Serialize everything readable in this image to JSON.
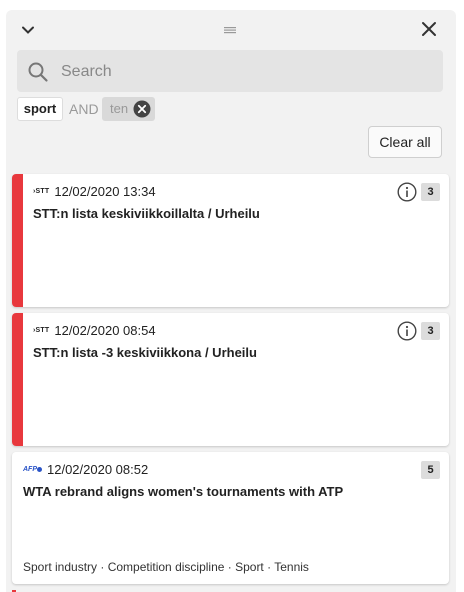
{
  "search": {
    "placeholder": "Search",
    "value": ""
  },
  "filters": [
    {
      "label": "sport"
    },
    {
      "operator": "AND"
    },
    {
      "label": "ten"
    }
  ],
  "clear_all_label": "Clear all",
  "colors": {
    "urgent": "#e8383d",
    "afp": "#2a54c7"
  },
  "items": [
    {
      "source": "STT",
      "source_icon": "stt-logo",
      "date": "12/02/2020 13:34",
      "title": "STT:n lista keskiviikkoillalta / Urheilu",
      "count": "3",
      "urgent": true,
      "has_info": true,
      "tags": ""
    },
    {
      "source": "STT",
      "source_icon": "stt-logo",
      "date": "12/02/2020 08:54",
      "title": "STT:n lista -3 keskiviikkona / Urheilu",
      "count": "3",
      "urgent": true,
      "has_info": true,
      "tags": ""
    },
    {
      "source": "AFP",
      "source_icon": "afp-logo",
      "date": "12/02/2020 08:52",
      "title": "WTA rebrand aligns women's tournaments with ATP",
      "count": "5",
      "urgent": false,
      "has_info": false,
      "tags": "Sport industry · Competition discipline · Sport · Tennis"
    }
  ]
}
